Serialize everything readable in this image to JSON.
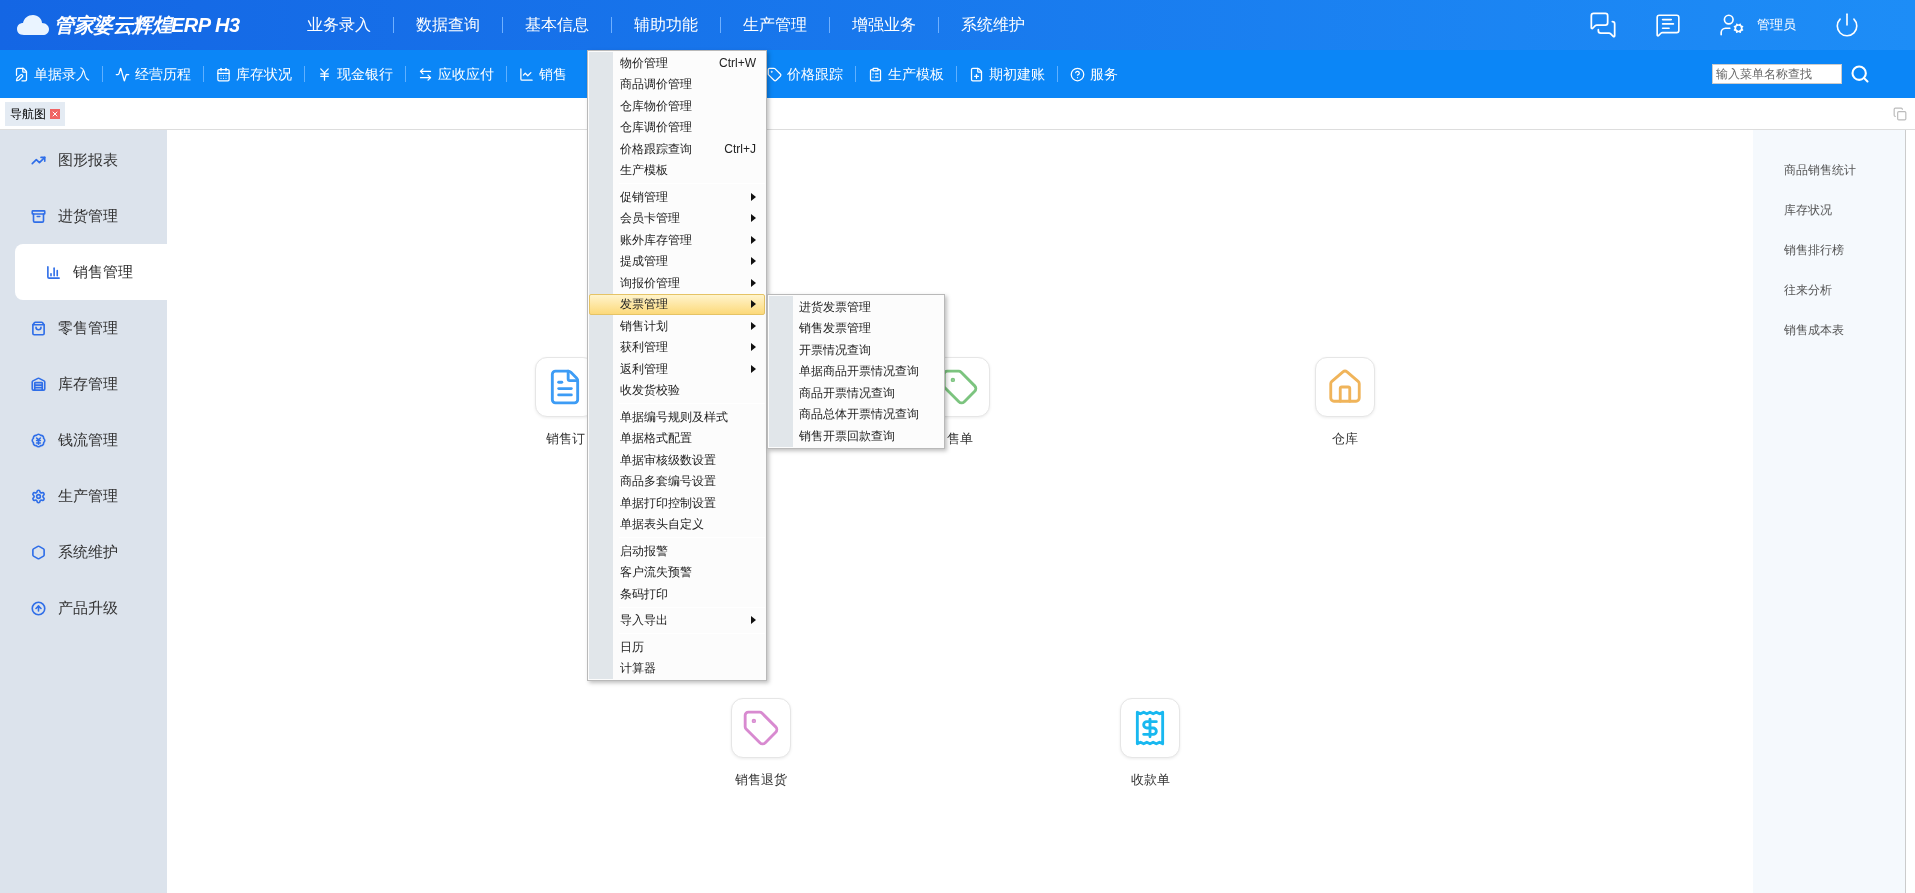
{
  "header": {
    "logo": "管家婆云辉煌ERP H3",
    "nav": [
      {
        "label": "业务录入"
      },
      {
        "label": "数据查询"
      },
      {
        "label": "基本信息"
      },
      {
        "label": "辅助功能"
      },
      {
        "label": "生产管理"
      },
      {
        "label": "增强业务"
      },
      {
        "label": "系统维护"
      }
    ],
    "user": "管理员"
  },
  "toolbar": {
    "items": [
      {
        "label": "单据录入"
      },
      {
        "label": "经营历程"
      },
      {
        "label": "库存状况"
      },
      {
        "label": "现金银行"
      },
      {
        "label": "应收应付"
      },
      {
        "label": "销售"
      }
    ],
    "items_after_menu": [
      {
        "label": "价格跟踪"
      },
      {
        "label": "生产模板"
      },
      {
        "label": "期初建账"
      },
      {
        "label": "服务"
      }
    ],
    "search": {
      "placeholder": "输入菜单名称查找"
    }
  },
  "tabs": [
    {
      "label": "导航图",
      "selected": true
    }
  ],
  "sidebar": {
    "items": [
      {
        "label": "图形报表",
        "selected": false
      },
      {
        "label": "进货管理",
        "selected": false
      },
      {
        "label": "销售管理",
        "selected": true
      },
      {
        "label": "零售管理",
        "selected": false
      },
      {
        "label": "库存管理",
        "selected": false
      },
      {
        "label": "钱流管理",
        "selected": false
      },
      {
        "label": "生产管理",
        "selected": false
      },
      {
        "label": "系统维护",
        "selected": false
      },
      {
        "label": "产品升级",
        "selected": false
      }
    ]
  },
  "tiles": [
    {
      "label": "销售订"
    },
    {
      "label": "售单"
    },
    {
      "label": "仓库"
    },
    {
      "label": "销售退货"
    },
    {
      "label": "收款单"
    }
  ],
  "quick_links": [
    "商品销售统计",
    "库存状况",
    "销售排行榜",
    "往来分析",
    "销售成本表"
  ],
  "menu": {
    "groups": [
      [
        {
          "label": "物价管理",
          "shortcut": "Ctrl+W",
          "submenu": false,
          "selected": false
        },
        {
          "label": "商品调价管理",
          "submenu": false,
          "selected": false
        },
        {
          "label": "仓库物价管理",
          "submenu": false,
          "selected": false
        },
        {
          "label": "仓库调价管理",
          "submenu": false,
          "selected": false
        },
        {
          "label": "价格跟踪查询",
          "shortcut": "Ctrl+J",
          "submenu": false,
          "selected": false
        },
        {
          "label": "生产模板",
          "submenu": false,
          "selected": false
        }
      ],
      [
        {
          "label": "促销管理",
          "submenu": true,
          "selected": false
        },
        {
          "label": "会员卡管理",
          "submenu": true,
          "selected": false
        },
        {
          "label": "账外库存管理",
          "submenu": true,
          "selected": false
        },
        {
          "label": "提成管理",
          "submenu": true,
          "selected": false
        },
        {
          "label": "询报价管理",
          "submenu": true,
          "selected": false
        },
        {
          "label": "发票管理",
          "submenu": true,
          "selected": true
        },
        {
          "label": "销售计划",
          "submenu": true,
          "selected": false
        },
        {
          "label": "获利管理",
          "submenu": true,
          "selected": false
        },
        {
          "label": "返利管理",
          "submenu": true,
          "selected": false
        },
        {
          "label": "收发货校验",
          "submenu": false,
          "selected": false
        }
      ],
      [
        {
          "label": "单据编号规则及样式",
          "submenu": false,
          "selected": false
        },
        {
          "label": "单据格式配置",
          "submenu": false,
          "selected": false
        },
        {
          "label": "单据审核级数设置",
          "submenu": false,
          "selected": false
        },
        {
          "label": "商品多套编号设置",
          "submenu": false,
          "selected": false
        },
        {
          "label": "单据打印控制设置",
          "submenu": false,
          "selected": false
        },
        {
          "label": "单据表头自定义",
          "submenu": false,
          "selected": false
        }
      ],
      [
        {
          "label": "启动报警",
          "submenu": false,
          "selected": false
        },
        {
          "label": "客户流失预警",
          "submenu": false,
          "selected": false
        },
        {
          "label": "条码打印",
          "submenu": false,
          "selected": false
        }
      ],
      [
        {
          "label": "导入导出",
          "submenu": true,
          "selected": false
        }
      ],
      [
        {
          "label": "日历",
          "submenu": false,
          "selected": false
        },
        {
          "label": "计算器",
          "submenu": false,
          "selected": false
        }
      ]
    ],
    "submenu": [
      {
        "label": "进货发票管理"
      },
      {
        "label": "销售发票管理"
      },
      {
        "label": "开票情况查询"
      },
      {
        "label": "单据商品开票情况查询"
      },
      {
        "label": "商品开票情况查询"
      },
      {
        "label": "商品总体开票情况查询"
      },
      {
        "label": "销售开票回款查询"
      }
    ]
  }
}
